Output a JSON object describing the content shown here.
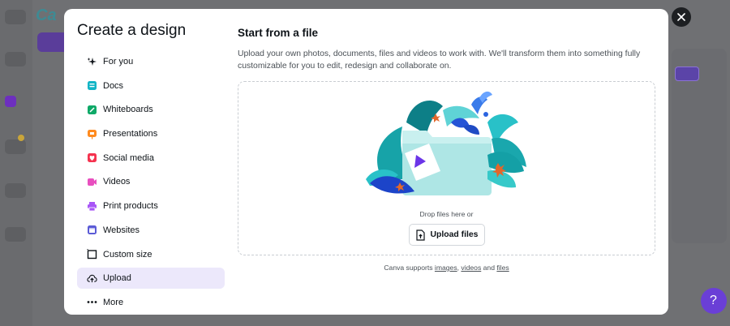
{
  "modal": {
    "title": "Create a design",
    "close_label": "×"
  },
  "menu": {
    "items": [
      {
        "label": "For you",
        "icon": "sparkle-icon"
      },
      {
        "label": "Docs",
        "icon": "docs-icon"
      },
      {
        "label": "Whiteboards",
        "icon": "whiteboard-icon"
      },
      {
        "label": "Presentations",
        "icon": "presentation-icon"
      },
      {
        "label": "Social media",
        "icon": "social-media-icon"
      },
      {
        "label": "Videos",
        "icon": "video-icon"
      },
      {
        "label": "Print products",
        "icon": "printer-icon"
      },
      {
        "label": "Websites",
        "icon": "website-icon"
      },
      {
        "label": "Custom size",
        "icon": "crop-icon"
      },
      {
        "label": "Upload",
        "icon": "upload-cloud-icon",
        "active": true
      },
      {
        "label": "More",
        "icon": "more-dots-icon"
      }
    ]
  },
  "content": {
    "title": "Start from a file",
    "description": "Upload your own photos, documents, files and videos to work with. We'll transform them into something fully customizable for you to edit, redesign and collaborate on.",
    "drop_text": "Drop files here or",
    "upload_button": "Upload files",
    "supports_prefix": "Canva supports",
    "supports_images": "images",
    "supports_sep": ",",
    "supports_videos": "videos",
    "supports_and": "and",
    "supports_files": "files"
  },
  "colors": {
    "accent": "#8b3dff",
    "active_bg": "#ece8fb",
    "teal": "#2ec4c4"
  }
}
